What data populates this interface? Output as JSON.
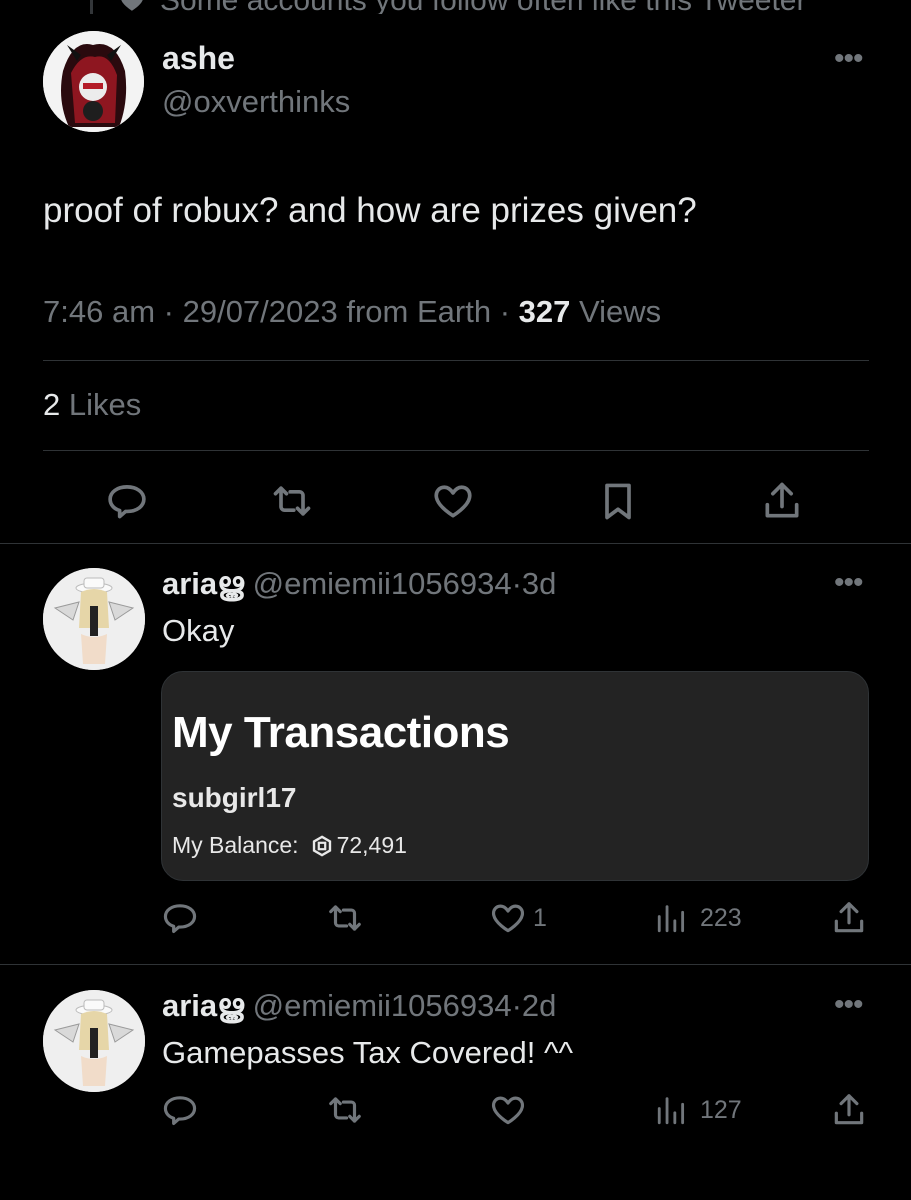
{
  "context": {
    "text": "Some accounts you follow often like this Tweeter"
  },
  "tweet": {
    "name": "ashe",
    "handle": "@oxverthinks",
    "text": "proof of robux? and how are prizes given?",
    "time": "7:46 am",
    "date": "29/07/2023",
    "source": "from Earth",
    "views_count": "327",
    "views_label": "Views",
    "likes_count": "2",
    "likes_label": "Likes",
    "more_icon": "•••"
  },
  "replies": [
    {
      "name": "ariaൠ",
      "handle": "@emiemii1056934",
      "time": "3d",
      "text": "Okay",
      "likes": "1",
      "views": "223",
      "media": {
        "title": "My Transactions",
        "username": "subgirl17",
        "balance_label": "My Balance:",
        "balance_value": "72,491"
      }
    },
    {
      "name": "ariaൠ",
      "handle": "@emiemii1056934",
      "time": "2d",
      "text": "Gamepasses Tax Covered! ^^",
      "likes": "",
      "views": "127"
    }
  ],
  "separator": "·",
  "icons": {
    "reply": "reply-icon",
    "retweet": "retweet-icon",
    "like": "heart-icon",
    "bookmark": "bookmark-icon",
    "share": "share-icon",
    "views": "views-icon",
    "more": "more-icon"
  },
  "colors": {
    "background": "#000000",
    "text": "#e7e9ea",
    "muted": "#71767b",
    "divider": "#2f3336",
    "card": "#232323"
  }
}
